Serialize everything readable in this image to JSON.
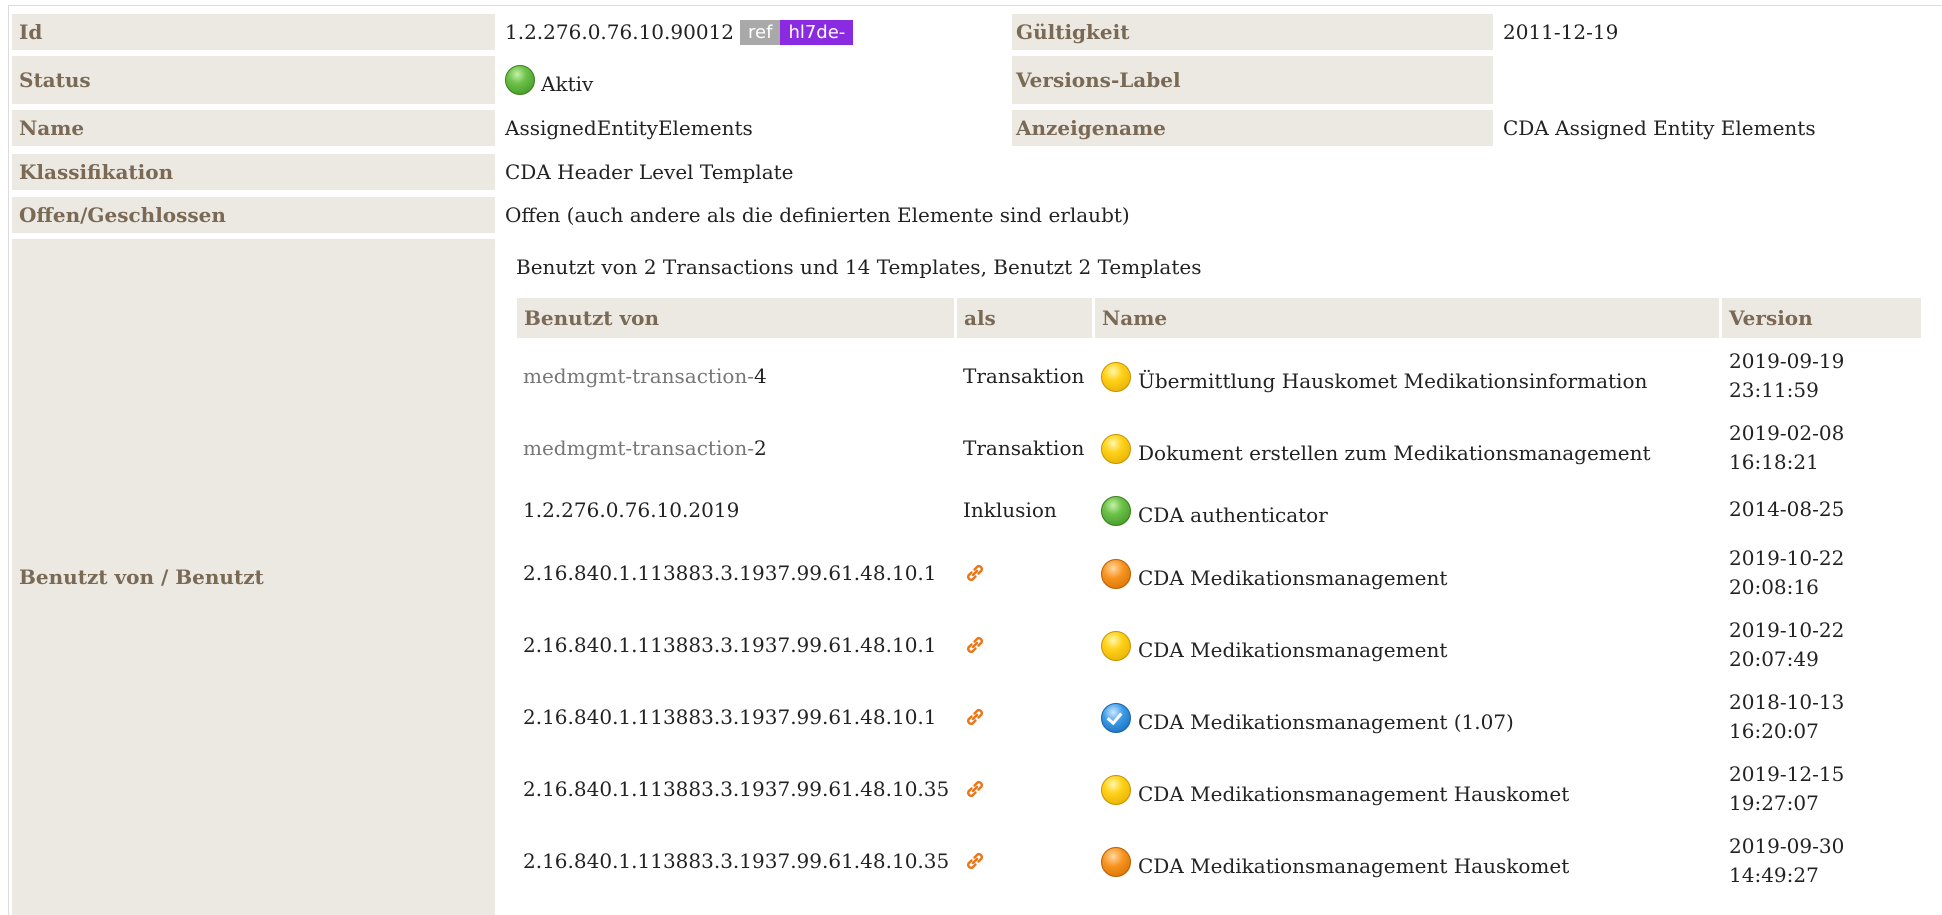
{
  "fields": {
    "id": {
      "label": "Id",
      "value": "1.2.276.0.76.10.90012",
      "badge_ref": "ref",
      "badge_prefix": "hl7de-"
    },
    "gueltigkeit": {
      "label": "Gültigkeit",
      "value": "2011-12-19"
    },
    "status": {
      "label": "Status",
      "value": "Aktiv",
      "icon": "status-active-green"
    },
    "versions_label": {
      "label": "Versions-Label",
      "value": ""
    },
    "name": {
      "label": "Name",
      "value": "AssignedEntityElements"
    },
    "anzeigename": {
      "label": "Anzeigename",
      "value": "CDA Assigned Entity Elements"
    },
    "klassifikation": {
      "label": "Klassifikation",
      "value": "CDA Header Level Template"
    },
    "offen": {
      "label": "Offen/Geschlossen",
      "value": "Offen (auch andere als die definierten Elemente sind erlaubt)"
    },
    "benutzt": {
      "label": "Benutzt von / Benutzt"
    }
  },
  "usage": {
    "summary": "Benutzt von 2 Transactions und 14 Templates, Benutzt 2 Templates",
    "columns": {
      "used_by": "Benutzt von",
      "as": "als",
      "name": "Name",
      "version": "Version"
    },
    "rows": [
      {
        "ref_prefix": "medmgmt-transaction-",
        "ref_suffix": "4",
        "as": "Transaktion",
        "status": "yellow",
        "name": "Übermittlung Hauskomet Medikationsinformation",
        "version_date": "2019-09-19",
        "version_time": "23:11:59"
      },
      {
        "ref_prefix": "medmgmt-transaction-",
        "ref_suffix": "2",
        "as": "Transaktion",
        "status": "yellow",
        "name": "Dokument erstellen zum Medikationsmanagement",
        "version_date": "2019-02-08",
        "version_time": "16:18:21"
      },
      {
        "ref_prefix": "",
        "ref_suffix": "1.2.276.0.76.10.2019",
        "as": "Inklusion",
        "status": "green",
        "name": "CDA authenticator",
        "version_date": "2014-08-25",
        "version_time": ""
      },
      {
        "ref_prefix": "",
        "ref_suffix": "2.16.840.1.113883.3.1937.99.61.48.10.1",
        "as": "link-icon",
        "status": "orange",
        "name": "CDA Medikationsmanagement",
        "version_date": "2019-10-22",
        "version_time": "20:08:16"
      },
      {
        "ref_prefix": "",
        "ref_suffix": "2.16.840.1.113883.3.1937.99.61.48.10.1",
        "as": "link-icon",
        "status": "yellow",
        "name": "CDA Medikationsmanagement",
        "version_date": "2019-10-22",
        "version_time": "20:07:49"
      },
      {
        "ref_prefix": "",
        "ref_suffix": "2.16.840.1.113883.3.1937.99.61.48.10.1",
        "as": "link-icon",
        "status": "blue-check",
        "name": "CDA Medikationsmanagement (1.07)",
        "version_date": "2018-10-13",
        "version_time": "16:20:07"
      },
      {
        "ref_prefix": "",
        "ref_suffix": "2.16.840.1.113883.3.1937.99.61.48.10.35",
        "as": "link-icon",
        "status": "yellow",
        "name": "CDA Medikationsmanagement Hauskomet",
        "version_date": "2019-12-15",
        "version_time": "19:27:07"
      },
      {
        "ref_prefix": "",
        "ref_suffix": "2.16.840.1.113883.3.1937.99.61.48.10.35",
        "as": "link-icon",
        "status": "orange",
        "name": "CDA Medikationsmanagement Hauskomet",
        "version_date": "2019-09-30",
        "version_time": "14:49:27"
      }
    ]
  }
}
